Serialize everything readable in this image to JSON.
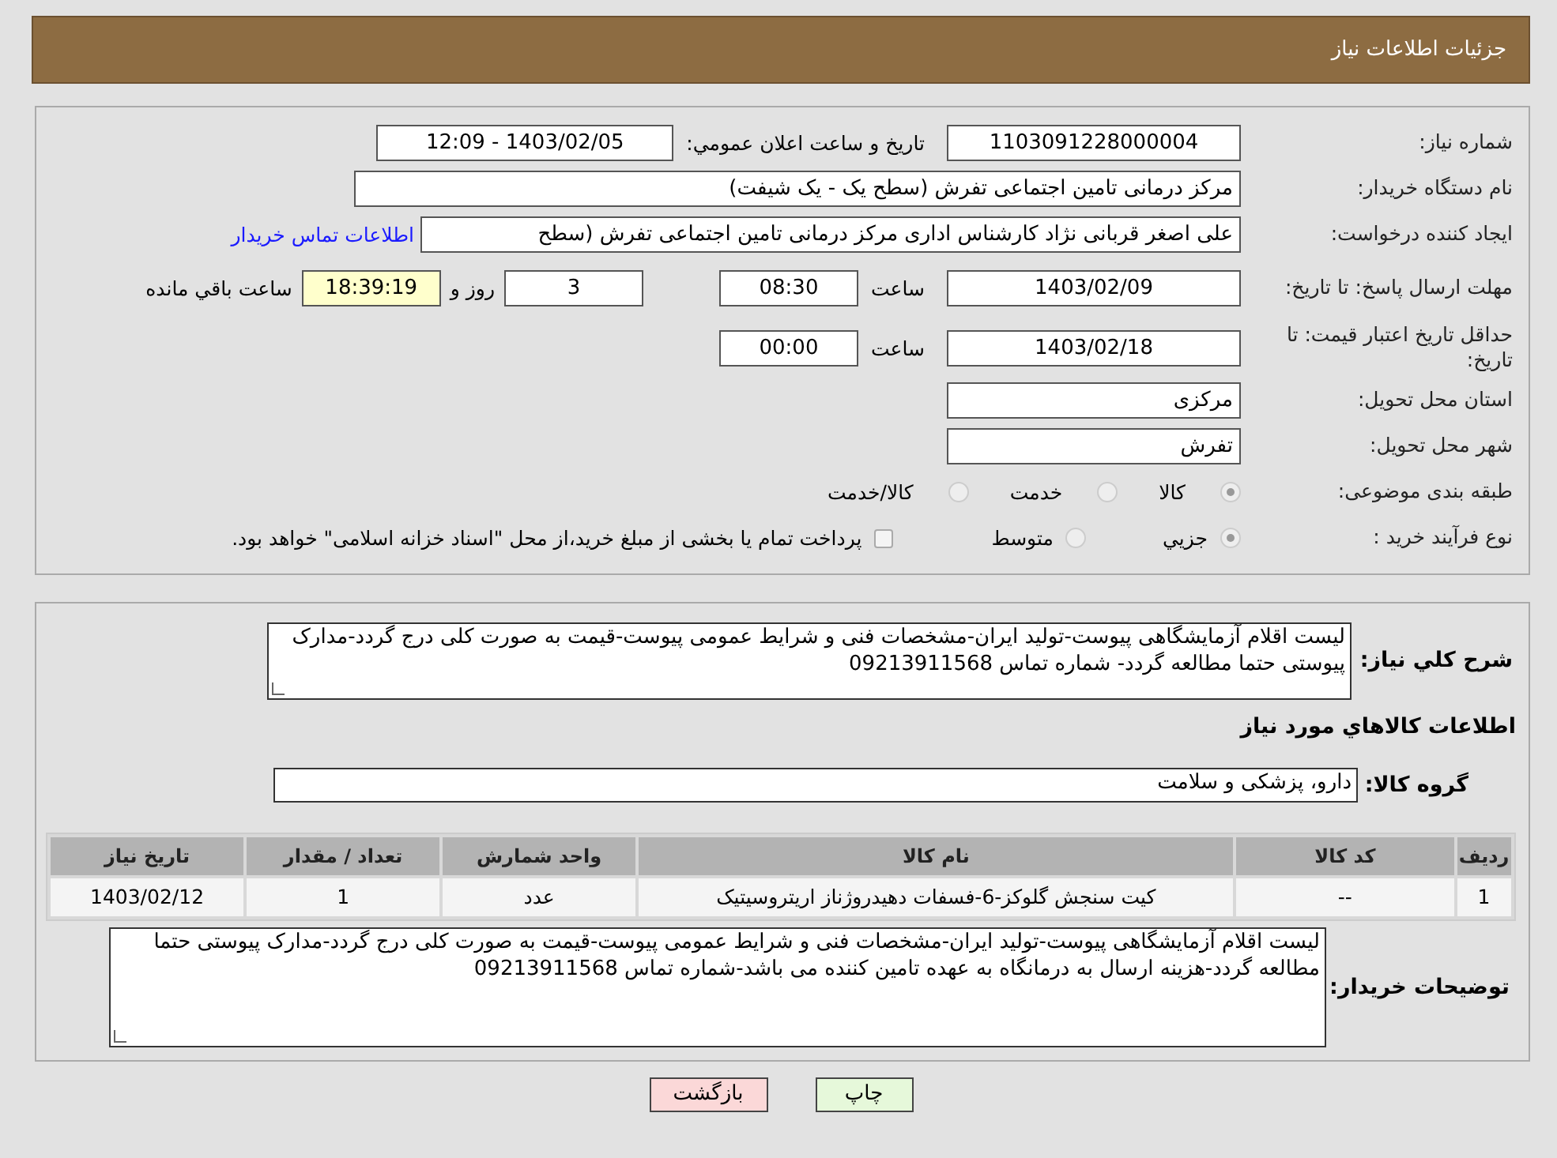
{
  "header": {
    "title": "جزئیات اطلاعات نیاز"
  },
  "details": {
    "need_number": {
      "label": "شماره نیاز:",
      "value": "1103091228000004"
    },
    "announce": {
      "label": "تاریخ و ساعت اعلان عمومي:",
      "value": "1403/02/05 - 12:09"
    },
    "buyer_org": {
      "label": "نام دستگاه خریدار:",
      "value": "مرکز درمانی تامین اجتماعی تفرش (سطح یک - یک شیفت)"
    },
    "requester": {
      "label": "ایجاد کننده درخواست:",
      "value": "علی اصغر قربانی نژاد کارشناس اداری مرکز درمانی تامین اجتماعی تفرش (سطح",
      "link": "اطلاعات تماس خریدار"
    },
    "reply_deadline": {
      "label": "مهلت ارسال پاسخ: تا تاریخ:",
      "date": "1403/02/09",
      "time_label": "ساعت",
      "time": "08:30",
      "days": "3",
      "days_label": "روز و",
      "remaining": "18:39:19",
      "remaining_label": "ساعت باقي مانده"
    },
    "price_validity": {
      "label": "حداقل تاریخ اعتبار قیمت: تا تاریخ:",
      "date": "1403/02/18",
      "time_label": "ساعت",
      "time": "00:00"
    },
    "province": {
      "label": "استان محل تحویل:",
      "value": "مرکزی"
    },
    "city": {
      "label": "شهر محل تحویل:",
      "value": "تفرش"
    },
    "category": {
      "label": "طبقه بندی موضوعی:",
      "options": [
        {
          "label": "کالا",
          "selected": true
        },
        {
          "label": "خدمت",
          "selected": false
        },
        {
          "label": "کالا/خدمت",
          "selected": false
        }
      ]
    },
    "purchase_type": {
      "label": "نوع فرآیند خرید :",
      "options": [
        {
          "label": "جزيي",
          "selected": true
        },
        {
          "label": "متوسط",
          "selected": false
        }
      ],
      "payment": {
        "checked": false,
        "text": "پرداخت تمام یا بخشی از مبلغ خرید،از محل \"اسناد خزانه اسلامی\" خواهد بود."
      }
    }
  },
  "summary": {
    "label": "شرح کلي نیاز:",
    "value": "لیست اقلام آزمایشگاهی پیوست-تولید ایران-مشخصات فنی و شرایط عمومی پیوست-قیمت به صورت کلی درج گردد-مدارک پیوستی حتما مطالعه گردد- شماره تماس 09213911568"
  },
  "goods_title": "اطلاعات کالاهاي مورد نیاز",
  "goods_group": {
    "label": "گروه کالا:",
    "value": "دارو، پزشکی و سلامت"
  },
  "table": {
    "columns": [
      "ردیف",
      "کد کالا",
      "نام کالا",
      "واحد شمارش",
      "تعداد / مقدار",
      "تاریخ نیاز"
    ],
    "rows": [
      [
        "1",
        "--",
        "کیت سنجش گلوکز-6-فسفات دهیدروژناز اریتروسیتیک",
        "عدد",
        "1",
        "1403/02/12"
      ]
    ]
  },
  "buyer_notes": {
    "label": "توضیحات خریدار:",
    "value": "لیست اقلام آزمایشگاهی پیوست-تولید ایران-مشخصات فنی و شرایط عمومی پیوست-قیمت به صورت کلی درج گردد-مدارک پیوستی حتما مطالعه گردد-هزینه ارسال به درمانگاه به عهده تامین کننده می باشد-شماره تماس 09213911568"
  },
  "buttons": [
    {
      "kind": "print",
      "label": "چاپ"
    },
    {
      "kind": "back",
      "label": "بازگشت"
    }
  ]
}
